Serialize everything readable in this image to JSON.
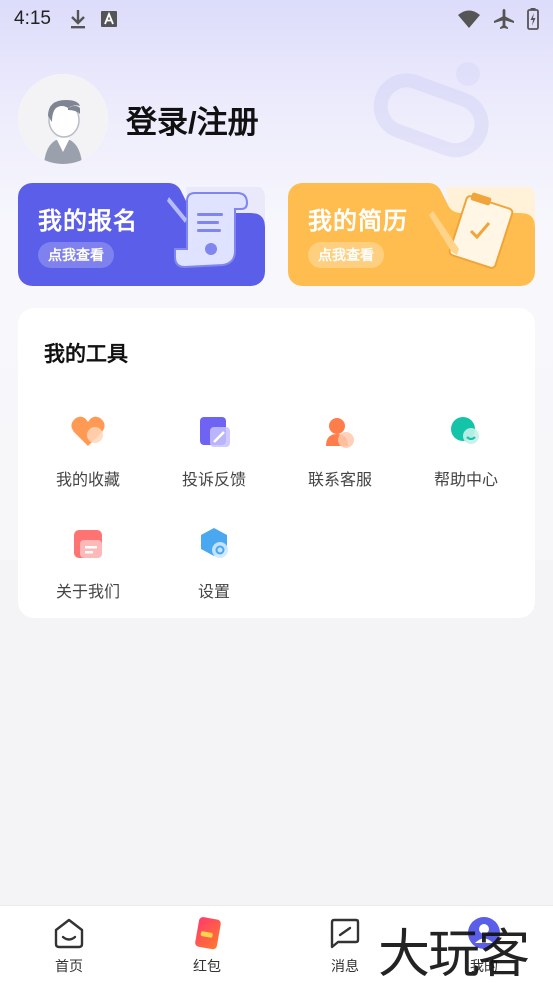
{
  "status_bar": {
    "time": "4:15"
  },
  "profile": {
    "login_text": "登录/注册"
  },
  "cards": {
    "registration": {
      "title": "我的报名",
      "button": "点我查看",
      "color": "#5a5ee8"
    },
    "resume": {
      "title": "我的简历",
      "button": "点我查看",
      "color": "#ffb84a"
    }
  },
  "tools": {
    "title": "我的工具",
    "items": [
      {
        "label": "我的收藏",
        "icon": "heart-icon"
      },
      {
        "label": "投诉反馈",
        "icon": "edit-icon"
      },
      {
        "label": "联系客服",
        "icon": "customer-service-icon"
      },
      {
        "label": "帮助中心",
        "icon": "help-chat-icon"
      },
      {
        "label": "关于我们",
        "icon": "info-card-icon"
      },
      {
        "label": "设置",
        "icon": "settings-icon"
      }
    ]
  },
  "bottom_nav": {
    "items": [
      {
        "label": "首页",
        "icon": "home-icon"
      },
      {
        "label": "红包",
        "icon": "red-packet-icon"
      },
      {
        "label": "消息",
        "icon": "message-icon"
      },
      {
        "label": "我的",
        "icon": "profile-icon",
        "active": true
      }
    ]
  },
  "watermark": "大玩客"
}
